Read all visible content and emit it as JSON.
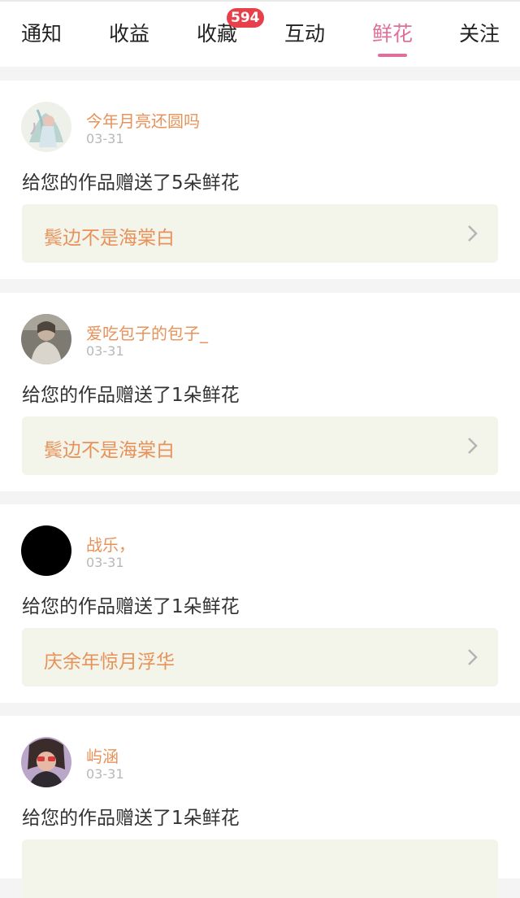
{
  "tabs": [
    {
      "label": "通知"
    },
    {
      "label": "收益"
    },
    {
      "label": "收藏",
      "badge": "594"
    },
    {
      "label": "互动"
    },
    {
      "label": "鲜花",
      "active": true
    },
    {
      "label": "关注"
    }
  ],
  "accent_color": "#e0709a",
  "link_color": "#e8925a",
  "notifications": [
    {
      "username": "今年月亮还圆吗",
      "date": "03-31",
      "message": "给您的作品赠送了5朵鲜花",
      "work_title": "鬓边不是海棠白",
      "avatar": "anime-illustration"
    },
    {
      "username": "爱吃包子的包子_",
      "date": "03-31",
      "message": "给您的作品赠送了1朵鲜花",
      "work_title": "鬓边不是海棠白",
      "avatar": "photo-person"
    },
    {
      "username": "战乐，",
      "date": "03-31",
      "message": "给您的作品赠送了1朵鲜花",
      "work_title": "庆余年惊月浮华",
      "avatar": "black-circle"
    },
    {
      "username": "屿涵",
      "date": "03-31",
      "message": "给您的作品赠送了1朵鲜花",
      "work_title": "",
      "avatar": "photo-person-sunglasses"
    }
  ]
}
